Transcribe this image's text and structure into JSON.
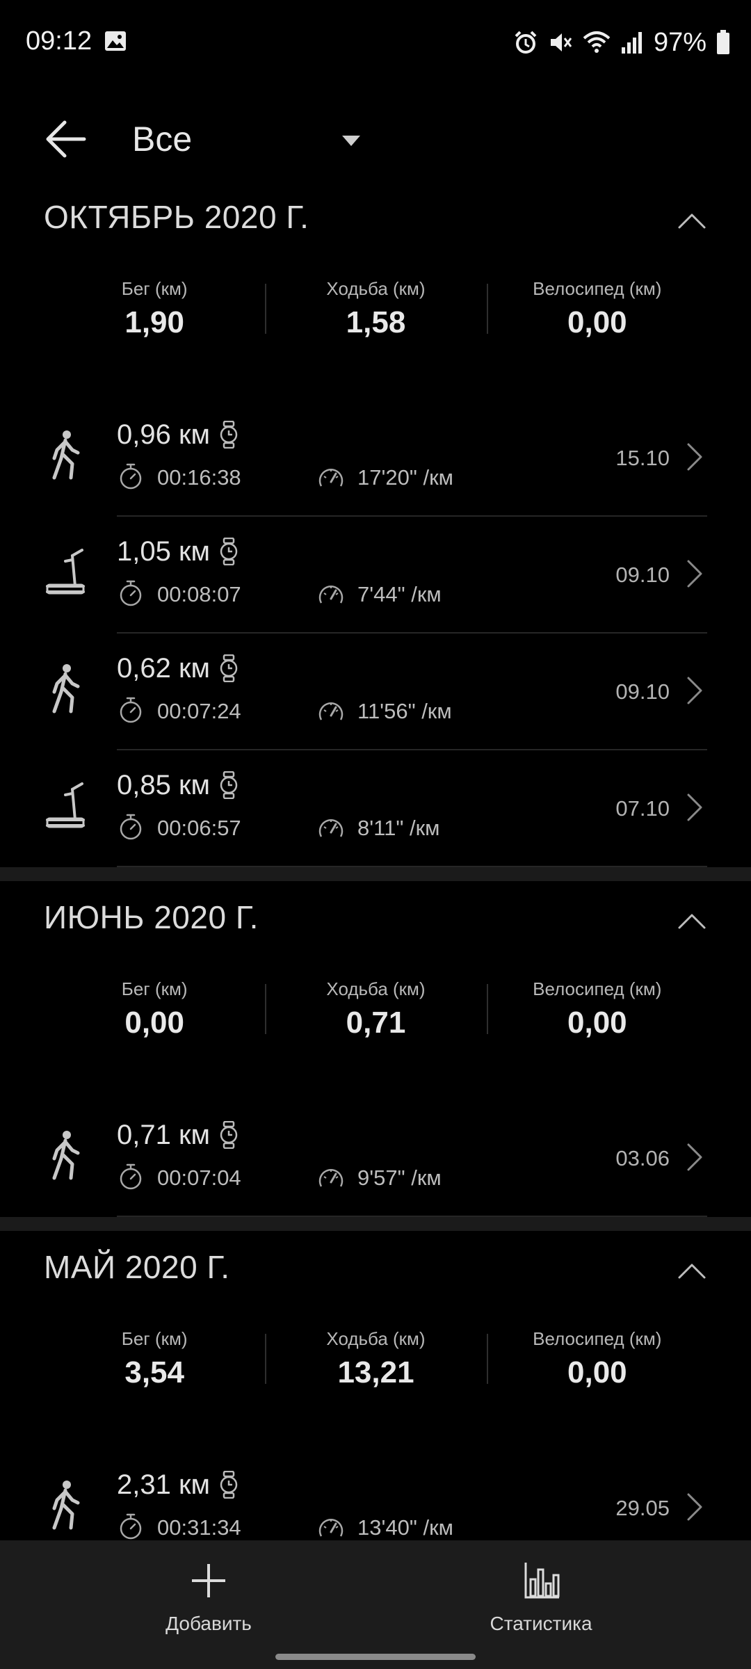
{
  "status_bar": {
    "time": "09:12",
    "battery": "97%",
    "icons": [
      "gallery-icon",
      "alarm-icon",
      "mute-icon",
      "wifi-icon",
      "signal-icon",
      "battery-icon"
    ]
  },
  "app_bar": {
    "filter_value": "Все"
  },
  "months": [
    {
      "title": "ОКТЯБРЬ 2020 Г.",
      "summary": [
        {
          "label": "Бег (км)",
          "value": "1,90"
        },
        {
          "label": "Ходьба (км)",
          "value": "1,58"
        },
        {
          "label": "Велосипед (км)",
          "value": "0,00"
        }
      ],
      "workouts": [
        {
          "type": "walk",
          "distance": "0,96 км",
          "duration": "00:16:38",
          "pace": "17'20\" /км",
          "date": "15.10"
        },
        {
          "type": "treadmill",
          "distance": "1,05 км",
          "duration": "00:08:07",
          "pace": "7'44\" /км",
          "date": "09.10"
        },
        {
          "type": "walk",
          "distance": "0,62 км",
          "duration": "00:07:24",
          "pace": "11'56\" /км",
          "date": "09.10"
        },
        {
          "type": "treadmill",
          "distance": "0,85 км",
          "duration": "00:06:57",
          "pace": "8'11\" /км",
          "date": "07.10"
        }
      ]
    },
    {
      "title": "ИЮНЬ 2020 Г.",
      "summary": [
        {
          "label": "Бег (км)",
          "value": "0,00"
        },
        {
          "label": "Ходьба (км)",
          "value": "0,71"
        },
        {
          "label": "Велосипед (км)",
          "value": "0,00"
        }
      ],
      "workouts": [
        {
          "type": "walk",
          "distance": "0,71 км",
          "duration": "00:07:04",
          "pace": "9'57\" /км",
          "date": "03.06"
        }
      ]
    },
    {
      "title": "МАЙ 2020 Г.",
      "summary": [
        {
          "label": "Бег (км)",
          "value": "3,54"
        },
        {
          "label": "Ходьба (км)",
          "value": "13,21"
        },
        {
          "label": "Велосипед (км)",
          "value": "0,00"
        }
      ],
      "workouts": [
        {
          "type": "walk",
          "distance": "2,31 км",
          "duration": "00:31:34",
          "pace": "13'40\" /км",
          "date": "29.05"
        }
      ]
    }
  ],
  "bottom_bar": {
    "add_label": "Добавить",
    "stats_label": "Статистика"
  }
}
